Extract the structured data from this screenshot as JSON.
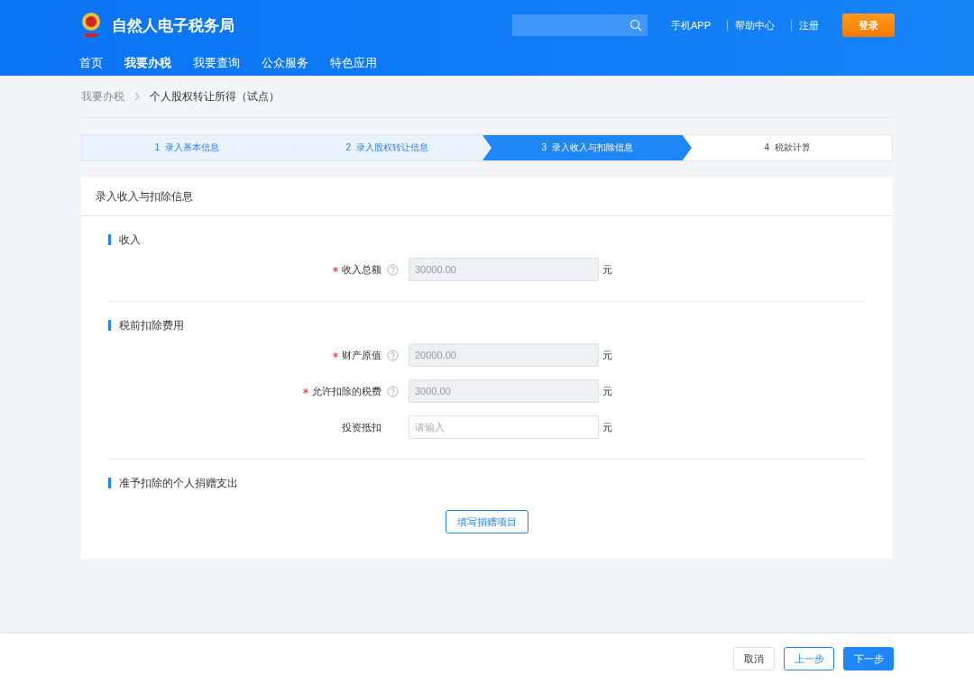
{
  "header": {
    "logo_text": "自然人电子税务局",
    "links": [
      "手机APP",
      "帮助中心",
      "注册"
    ],
    "login": "登录"
  },
  "nav": [
    {
      "label": "首页",
      "selected": false
    },
    {
      "label": "我要办税",
      "selected": true
    },
    {
      "label": "我要查询",
      "selected": false
    },
    {
      "label": "公众服务",
      "selected": false
    },
    {
      "label": "特色应用",
      "selected": false
    }
  ],
  "breadcrumb": [
    "我要办税",
    "个人股权转让所得（试点）"
  ],
  "steps": [
    {
      "label": "1  录入基本信息",
      "kind": "done"
    },
    {
      "label": "2  录入股权转让信息",
      "kind": "done"
    },
    {
      "label": "3  录入收入与扣除信息",
      "kind": "active"
    },
    {
      "label": "4  税款计算",
      "kind": "pending"
    }
  ],
  "card_title": "录入收入与扣除信息",
  "sections": [
    {
      "title": "收入",
      "fields": [
        {
          "label": "收入总额",
          "required": true,
          "help": true,
          "disabled": true,
          "value": "30000.00",
          "unit": "元"
        }
      ]
    },
    {
      "title": "税前扣除费用",
      "fields": [
        {
          "label": "财产原值",
          "required": true,
          "help": true,
          "disabled": true,
          "value": "20000.00",
          "unit": "元"
        },
        {
          "label": "允许扣除的税费",
          "required": true,
          "help": true,
          "disabled": true,
          "value": "3000.00",
          "unit": "元"
        },
        {
          "label": "投资抵扣",
          "required": false,
          "help": false,
          "disabled": false,
          "placeholder": "请输入",
          "unit": "元"
        }
      ]
    },
    {
      "title": "准予扣除的个人捐赠支出",
      "button": "填写捐赠项目"
    }
  ],
  "footer": [
    {
      "label": "取消",
      "kind": "plain"
    },
    {
      "label": "上一步",
      "kind": "outline"
    },
    {
      "label": "下一步",
      "kind": "primary"
    }
  ]
}
